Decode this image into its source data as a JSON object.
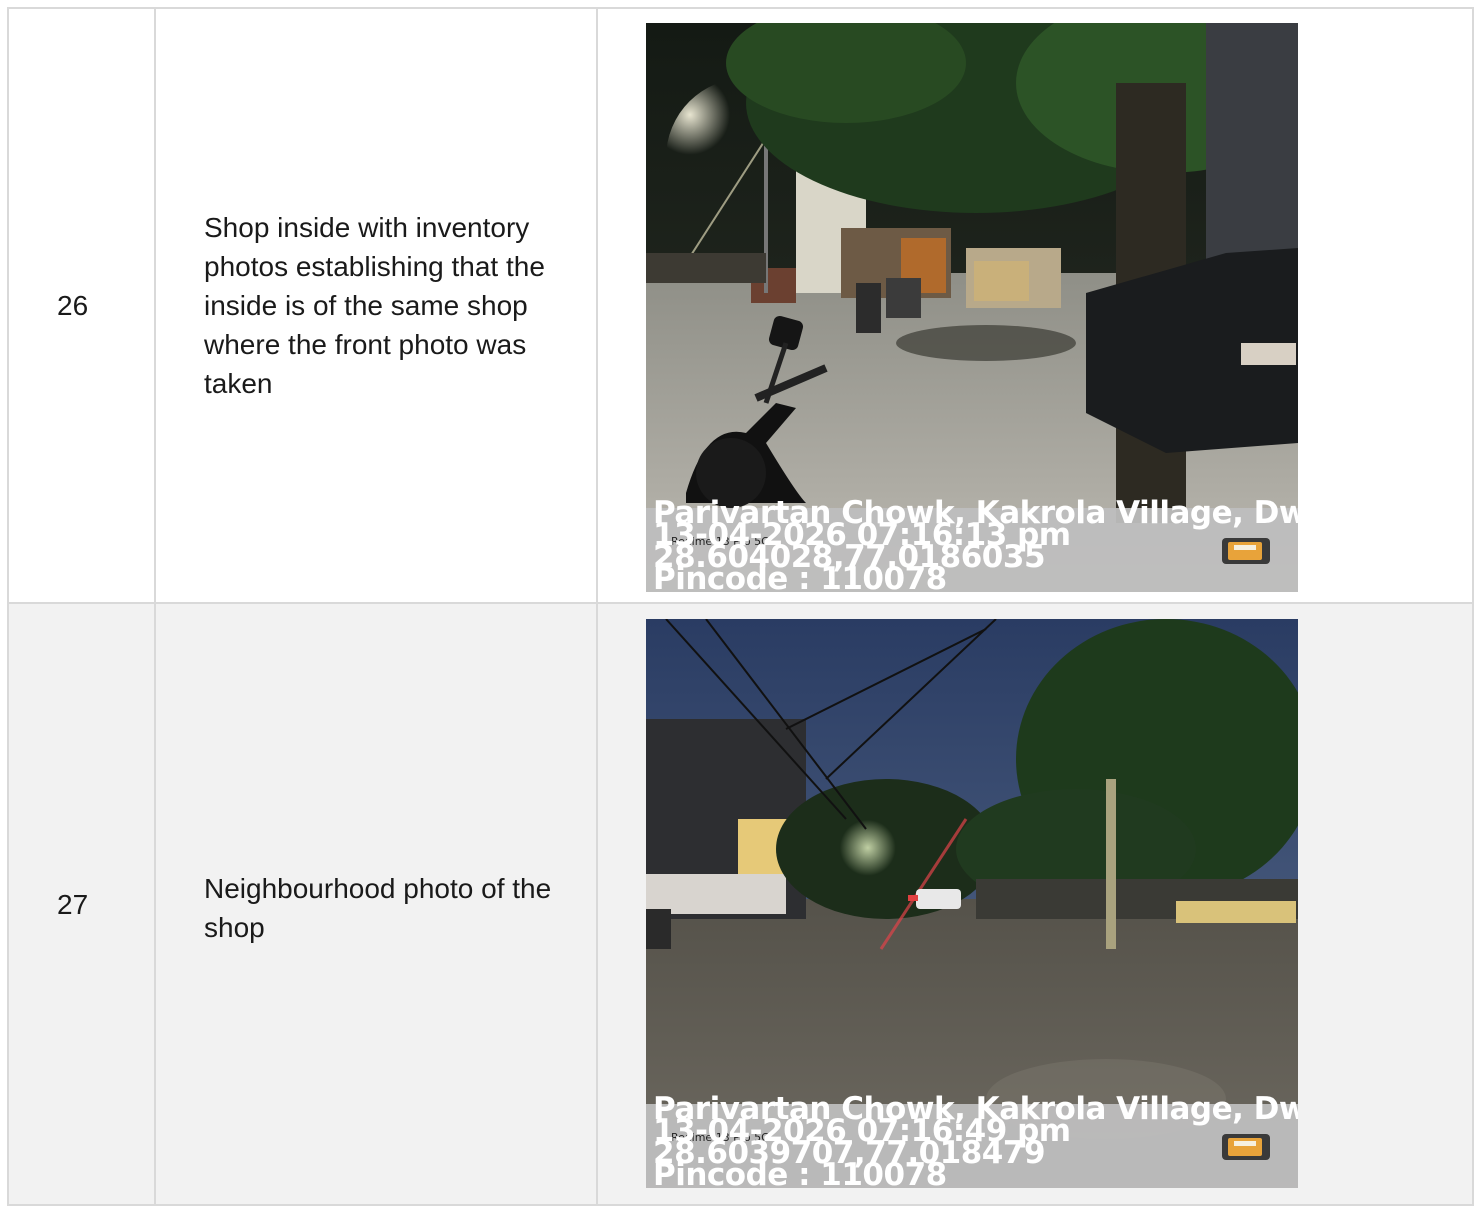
{
  "rows": [
    {
      "number": "26",
      "description": "Shop inside with inventory photos establishing that the inside is of the same shop where the front photo was taken",
      "photo": {
        "scene": "night street with parked motorcycle, trees and SUV",
        "stamp_lines": [
          "Parivartan Chowk, Kakrola Village, Dwarka",
          "13-04-2026 07:16:13 pm",
          "28.604028,77.0186035",
          "Pincode : 110078"
        ],
        "stamp_subtext": "Realme 13 Pro 5G",
        "icon": "film-roll-icon"
      }
    },
    {
      "number": "27",
      "description": "Neighbourhood photo of the shop",
      "photo": {
        "scene": "dusk road with trees, street light and school wall",
        "stamp_lines": [
          "Parivartan Chowk, Kakrola Village, Dwarka",
          "13-04-2026 07:16:49 pm",
          "28.6039707,77.018479",
          "Pincode : 110078"
        ],
        "stamp_subtext": "Realme 13 Pro 5G",
        "icon": "film-roll-icon"
      }
    }
  ]
}
